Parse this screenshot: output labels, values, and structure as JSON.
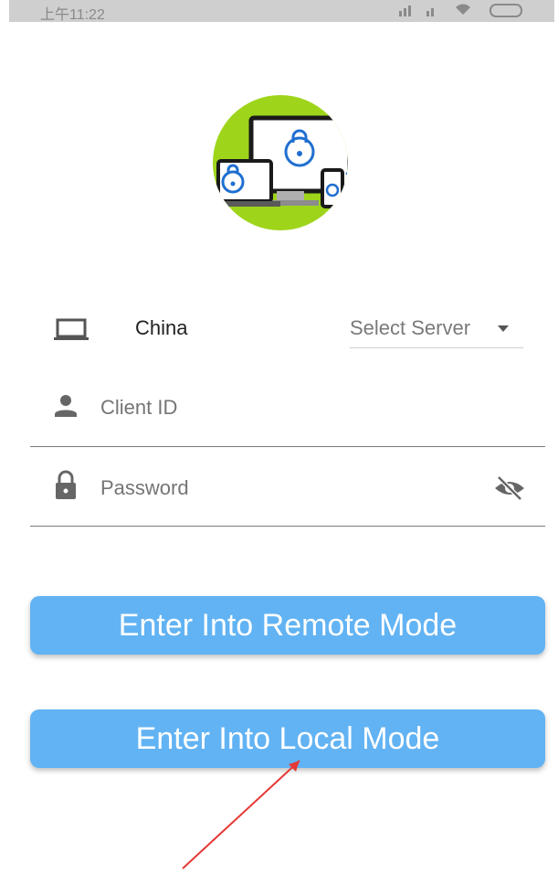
{
  "status_bar": {
    "time": "上午11:22",
    "right_text": ""
  },
  "server": {
    "country": "China",
    "select_label": "Select Server"
  },
  "client_id": {
    "placeholder": "Client ID"
  },
  "password": {
    "placeholder": "Password"
  },
  "buttons": {
    "remote": "Enter Into Remote Mode",
    "local": "Enter Into Local Mode"
  },
  "colors": {
    "button": "#62b3f3",
    "logo_bg": "#9ed51a",
    "annotation": "#e53935"
  }
}
